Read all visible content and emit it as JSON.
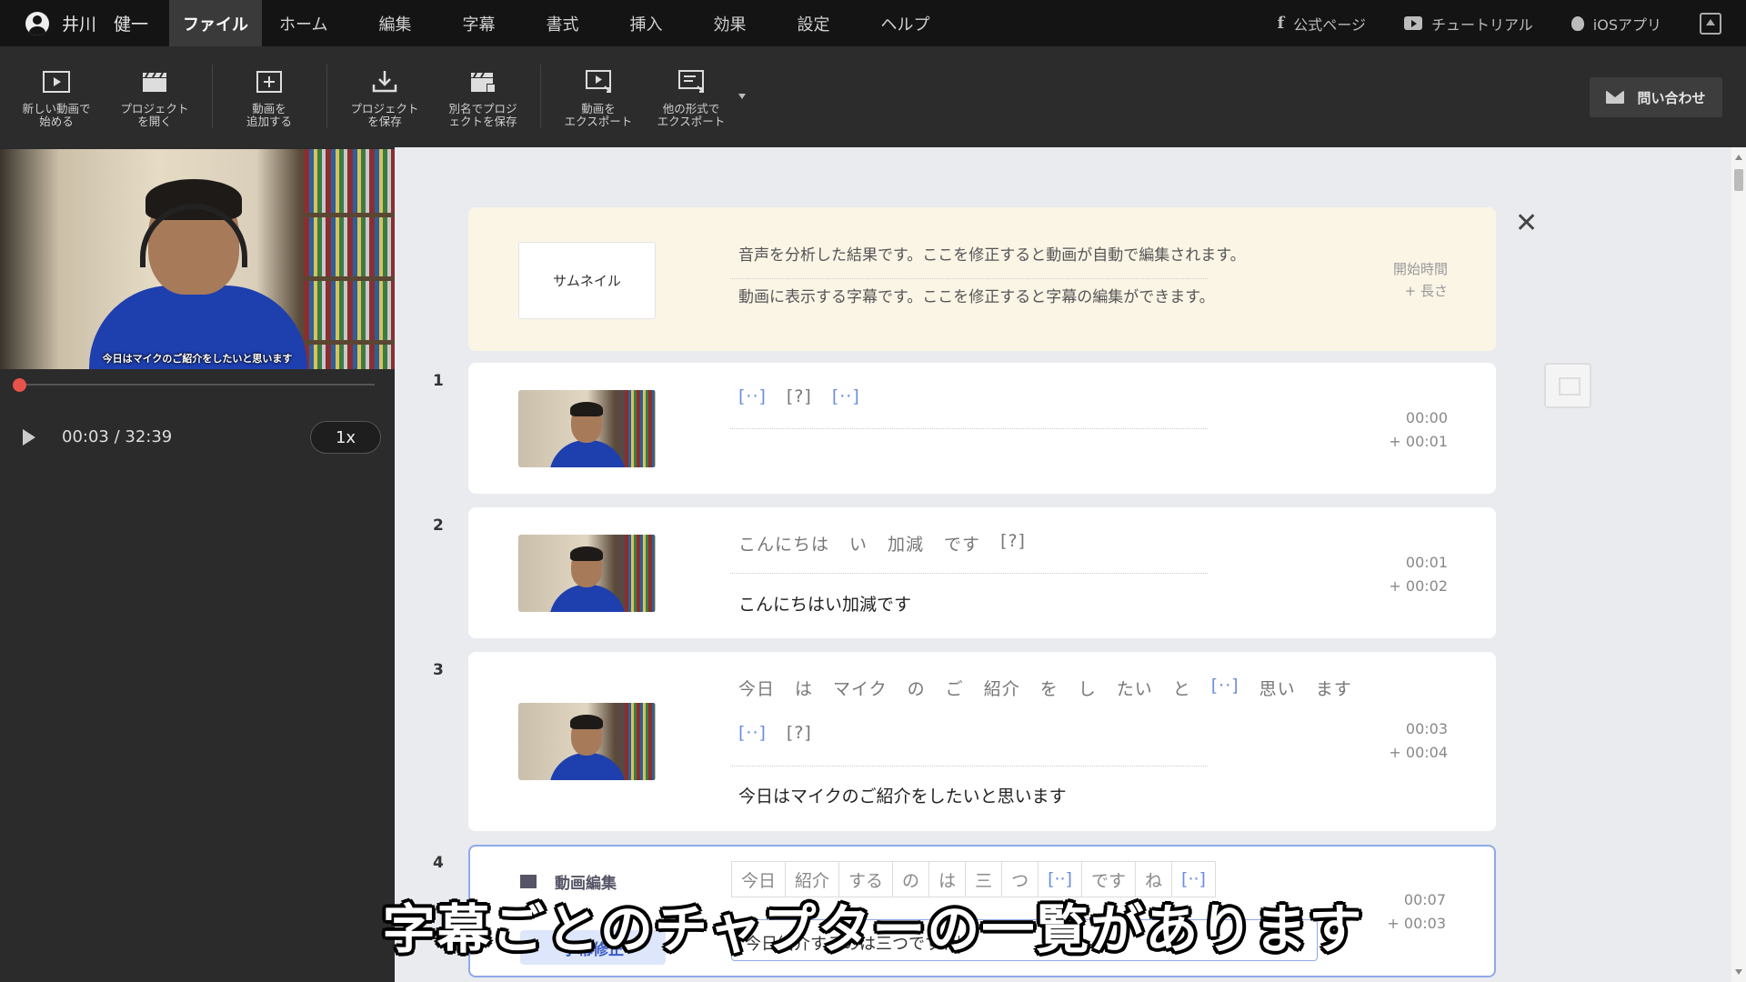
{
  "menubar": {
    "user_name": "井川　健一",
    "items": [
      "ファイル",
      "ホーム",
      "編集",
      "字幕",
      "書式",
      "挿入",
      "効果",
      "設定",
      "ヘルプ"
    ],
    "active_item": "ファイル",
    "links": {
      "facebook": "公式ページ",
      "youtube": "チュートリアル",
      "ios": "iOSアプリ"
    }
  },
  "toolbar": {
    "new_video": [
      "新しい動画で",
      "始める"
    ],
    "open_project": [
      "プロジェクト",
      "を開く"
    ],
    "add_video": [
      "動画を",
      "追加する"
    ],
    "save_project": [
      "プロジェクト",
      "を保存"
    ],
    "save_as": [
      "別名でプロジ",
      "ェクトを保存"
    ],
    "export_video": [
      "動画を",
      "エクスポート"
    ],
    "export_other": [
      "他の形式で",
      "エクスポート"
    ],
    "contact": "問い合わせ"
  },
  "player": {
    "video_caption": "今日はマイクのご紹介をしたいと思います",
    "time": "00:03 / 32:39",
    "speed": "1x",
    "progress": 0.0015
  },
  "header_card": {
    "thumbnail_label": "サムネイル",
    "analysis_text": "音声を分析した結果です。ここを修正すると動画が自動で編集されます。",
    "subtitle_text": "動画に表示する字幕です。ここを修正すると字幕の編集ができます。",
    "start_time_label": "開始時間",
    "length_label": "+ 長さ"
  },
  "rows": [
    {
      "num": "1",
      "words": [
        {
          "t": "[··]",
          "tag": true
        },
        {
          "t": "[?]",
          "tag": false
        },
        {
          "t": "[··]",
          "tag": true
        }
      ],
      "subtitle": "",
      "start": "00:00",
      "length": "+ 00:01"
    },
    {
      "num": "2",
      "words": [
        {
          "t": "こんにちは",
          "tag": false
        },
        {
          "t": "い",
          "tag": false
        },
        {
          "t": "加減",
          "tag": false
        },
        {
          "t": "です",
          "tag": false
        },
        {
          "t": "[?]",
          "tag": false
        }
      ],
      "subtitle": "こんにちはい加減です",
      "start": "00:01",
      "length": "+ 00:02"
    },
    {
      "num": "3",
      "words": [
        {
          "t": "今日",
          "tag": false
        },
        {
          "t": "は",
          "tag": false
        },
        {
          "t": "マイク",
          "tag": false
        },
        {
          "t": "の",
          "tag": false
        },
        {
          "t": "ご",
          "tag": false
        },
        {
          "t": "紹介",
          "tag": false
        },
        {
          "t": "を",
          "tag": false
        },
        {
          "t": "し",
          "tag": false
        },
        {
          "t": "たい",
          "tag": false
        },
        {
          "t": "と",
          "tag": false
        },
        {
          "t": "[··]",
          "tag": true
        },
        {
          "t": "思い",
          "tag": false
        },
        {
          "t": "ます",
          "tag": false
        }
      ],
      "words_line2": [
        {
          "t": "[··]",
          "tag": true
        },
        {
          "t": "[?]",
          "tag": false
        }
      ],
      "subtitle": "今日はマイクのご紹介をしたいと思います",
      "start": "00:03",
      "length": "+ 00:04"
    },
    {
      "num": "4",
      "edit_label": "動画編集",
      "fix_label": "字幕修正",
      "chips": [
        {
          "t": "今日",
          "tag": false
        },
        {
          "t": "紹介",
          "tag": false
        },
        {
          "t": "する",
          "tag": false
        },
        {
          "t": "の",
          "tag": false
        },
        {
          "t": "は",
          "tag": false
        },
        {
          "t": "三",
          "tag": false
        },
        {
          "t": "つ",
          "tag": false
        },
        {
          "t": "[··]",
          "tag": true
        },
        {
          "t": "です",
          "tag": false
        },
        {
          "t": "ね",
          "tag": false
        },
        {
          "t": "[··]",
          "tag": true
        }
      ],
      "subtitle": "今日紹介するのは三つですね",
      "start": "00:07",
      "length": "+ 00:03"
    }
  ],
  "overlay_caption": "字幕ごとのチャプターの一覧があります"
}
